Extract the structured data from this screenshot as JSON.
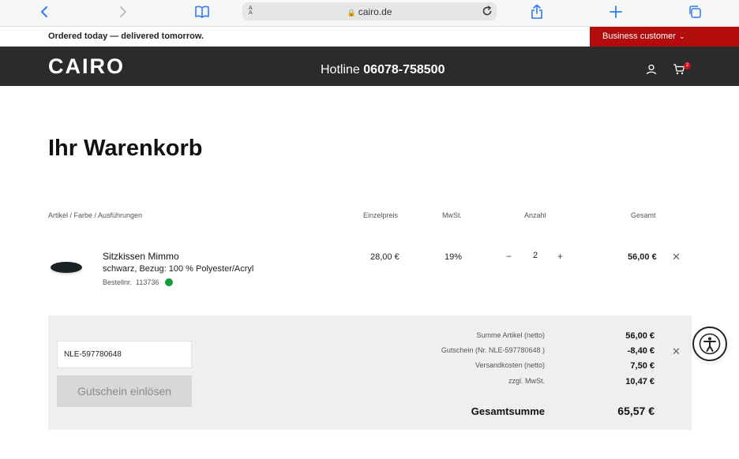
{
  "browser": {
    "url": "cairo.de",
    "text_size_label": "AA"
  },
  "info_bar": {
    "delivery_text": "Ordered today — delivered tomorrow.",
    "business_label": "Business customer"
  },
  "header": {
    "logo": "CAIRO",
    "hotline_label": "Hotline",
    "hotline_number": "06078-758500",
    "cart_count": "2"
  },
  "cart": {
    "title": "Ihr Warenkorb",
    "columns": {
      "article": "Artikel / Farbe / Ausführungen",
      "unit_price": "Einzelpreis",
      "vat": "MwSt.",
      "quantity": "Anzahl",
      "total": "Gesamt"
    },
    "items": [
      {
        "name": "Sitzkissen Mimmo",
        "description": "schwarz, Bezug: 100 % Polyester/Acryl",
        "order_label": "Bestellnr.",
        "order_number": "113736",
        "unit_price": "28,00 €",
        "vat": "19%",
        "quantity": "2",
        "minus": "−",
        "plus": "+",
        "total": "56,00 €",
        "availability_color": "#149b3a"
      }
    ]
  },
  "summary": {
    "voucher_value": "NLE-597780648",
    "voucher_button": "Gutschein einlösen",
    "rows": [
      {
        "label": "Summe Artikel (netto)",
        "value": "56,00 €"
      },
      {
        "label": "Gutschein (Nr. NLE-597780648 )",
        "value": "-8,40 €"
      },
      {
        "label": "Versandkosten (netto)",
        "value": "7,50 €"
      },
      {
        "label": "zzgl. MwSt.",
        "value": "10,47 €"
      }
    ],
    "total_label": "Gesamtsumme",
    "total_value": "65,57 €"
  },
  "colors": {
    "accent": "#b30c0c",
    "header_bg": "#2b2b2b",
    "browser_blue": "#2f7cf6"
  }
}
